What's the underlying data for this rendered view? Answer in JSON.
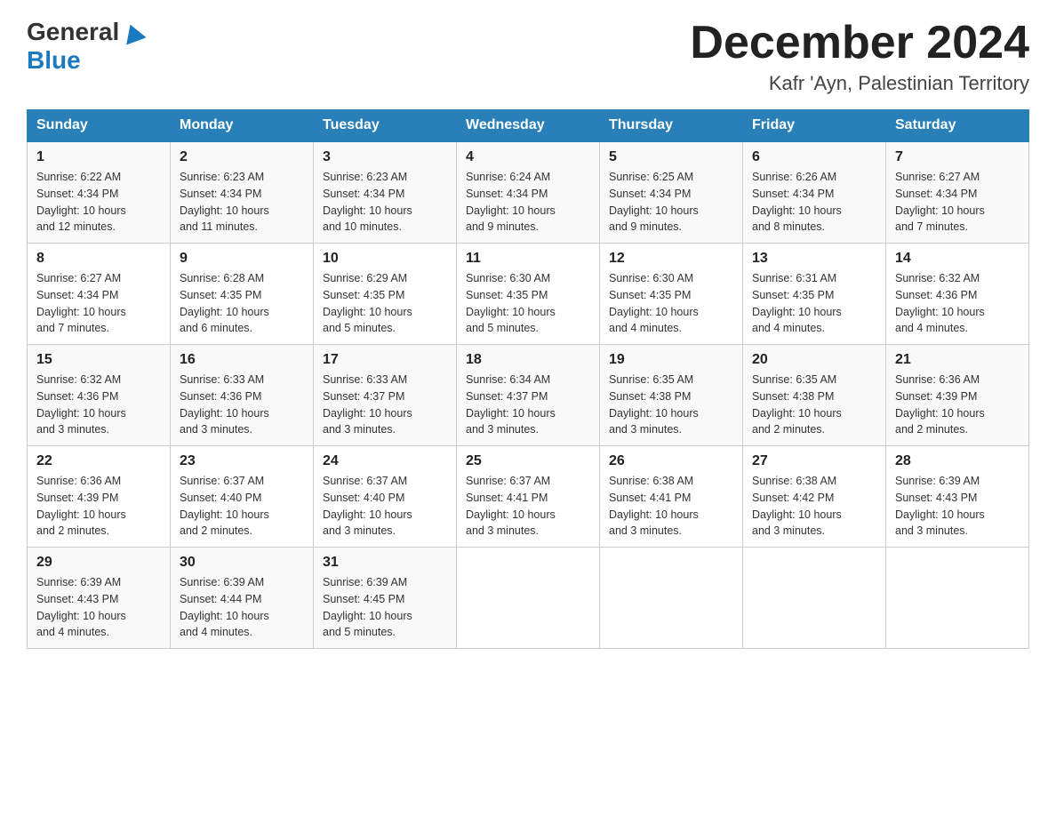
{
  "header": {
    "logo_general": "General",
    "logo_blue": "Blue",
    "title": "December 2024",
    "subtitle": "Kafr 'Ayn, Palestinian Territory"
  },
  "days_of_week": [
    "Sunday",
    "Monday",
    "Tuesday",
    "Wednesday",
    "Thursday",
    "Friday",
    "Saturday"
  ],
  "weeks": [
    [
      {
        "day": "1",
        "sunrise": "6:22 AM",
        "sunset": "4:34 PM",
        "daylight": "10 hours and 12 minutes."
      },
      {
        "day": "2",
        "sunrise": "6:23 AM",
        "sunset": "4:34 PM",
        "daylight": "10 hours and 11 minutes."
      },
      {
        "day": "3",
        "sunrise": "6:23 AM",
        "sunset": "4:34 PM",
        "daylight": "10 hours and 10 minutes."
      },
      {
        "day": "4",
        "sunrise": "6:24 AM",
        "sunset": "4:34 PM",
        "daylight": "10 hours and 9 minutes."
      },
      {
        "day": "5",
        "sunrise": "6:25 AM",
        "sunset": "4:34 PM",
        "daylight": "10 hours and 9 minutes."
      },
      {
        "day": "6",
        "sunrise": "6:26 AM",
        "sunset": "4:34 PM",
        "daylight": "10 hours and 8 minutes."
      },
      {
        "day": "7",
        "sunrise": "6:27 AM",
        "sunset": "4:34 PM",
        "daylight": "10 hours and 7 minutes."
      }
    ],
    [
      {
        "day": "8",
        "sunrise": "6:27 AM",
        "sunset": "4:34 PM",
        "daylight": "10 hours and 7 minutes."
      },
      {
        "day": "9",
        "sunrise": "6:28 AM",
        "sunset": "4:35 PM",
        "daylight": "10 hours and 6 minutes."
      },
      {
        "day": "10",
        "sunrise": "6:29 AM",
        "sunset": "4:35 PM",
        "daylight": "10 hours and 5 minutes."
      },
      {
        "day": "11",
        "sunrise": "6:30 AM",
        "sunset": "4:35 PM",
        "daylight": "10 hours and 5 minutes."
      },
      {
        "day": "12",
        "sunrise": "6:30 AM",
        "sunset": "4:35 PM",
        "daylight": "10 hours and 4 minutes."
      },
      {
        "day": "13",
        "sunrise": "6:31 AM",
        "sunset": "4:35 PM",
        "daylight": "10 hours and 4 minutes."
      },
      {
        "day": "14",
        "sunrise": "6:32 AM",
        "sunset": "4:36 PM",
        "daylight": "10 hours and 4 minutes."
      }
    ],
    [
      {
        "day": "15",
        "sunrise": "6:32 AM",
        "sunset": "4:36 PM",
        "daylight": "10 hours and 3 minutes."
      },
      {
        "day": "16",
        "sunrise": "6:33 AM",
        "sunset": "4:36 PM",
        "daylight": "10 hours and 3 minutes."
      },
      {
        "day": "17",
        "sunrise": "6:33 AM",
        "sunset": "4:37 PM",
        "daylight": "10 hours and 3 minutes."
      },
      {
        "day": "18",
        "sunrise": "6:34 AM",
        "sunset": "4:37 PM",
        "daylight": "10 hours and 3 minutes."
      },
      {
        "day": "19",
        "sunrise": "6:35 AM",
        "sunset": "4:38 PM",
        "daylight": "10 hours and 3 minutes."
      },
      {
        "day": "20",
        "sunrise": "6:35 AM",
        "sunset": "4:38 PM",
        "daylight": "10 hours and 2 minutes."
      },
      {
        "day": "21",
        "sunrise": "6:36 AM",
        "sunset": "4:39 PM",
        "daylight": "10 hours and 2 minutes."
      }
    ],
    [
      {
        "day": "22",
        "sunrise": "6:36 AM",
        "sunset": "4:39 PM",
        "daylight": "10 hours and 2 minutes."
      },
      {
        "day": "23",
        "sunrise": "6:37 AM",
        "sunset": "4:40 PM",
        "daylight": "10 hours and 2 minutes."
      },
      {
        "day": "24",
        "sunrise": "6:37 AM",
        "sunset": "4:40 PM",
        "daylight": "10 hours and 3 minutes."
      },
      {
        "day": "25",
        "sunrise": "6:37 AM",
        "sunset": "4:41 PM",
        "daylight": "10 hours and 3 minutes."
      },
      {
        "day": "26",
        "sunrise": "6:38 AM",
        "sunset": "4:41 PM",
        "daylight": "10 hours and 3 minutes."
      },
      {
        "day": "27",
        "sunrise": "6:38 AM",
        "sunset": "4:42 PM",
        "daylight": "10 hours and 3 minutes."
      },
      {
        "day": "28",
        "sunrise": "6:39 AM",
        "sunset": "4:43 PM",
        "daylight": "10 hours and 3 minutes."
      }
    ],
    [
      {
        "day": "29",
        "sunrise": "6:39 AM",
        "sunset": "4:43 PM",
        "daylight": "10 hours and 4 minutes."
      },
      {
        "day": "30",
        "sunrise": "6:39 AM",
        "sunset": "4:44 PM",
        "daylight": "10 hours and 4 minutes."
      },
      {
        "day": "31",
        "sunrise": "6:39 AM",
        "sunset": "4:45 PM",
        "daylight": "10 hours and 5 minutes."
      },
      null,
      null,
      null,
      null
    ]
  ],
  "labels": {
    "sunrise": "Sunrise: ",
    "sunset": "Sunset: ",
    "daylight": "Daylight: "
  }
}
